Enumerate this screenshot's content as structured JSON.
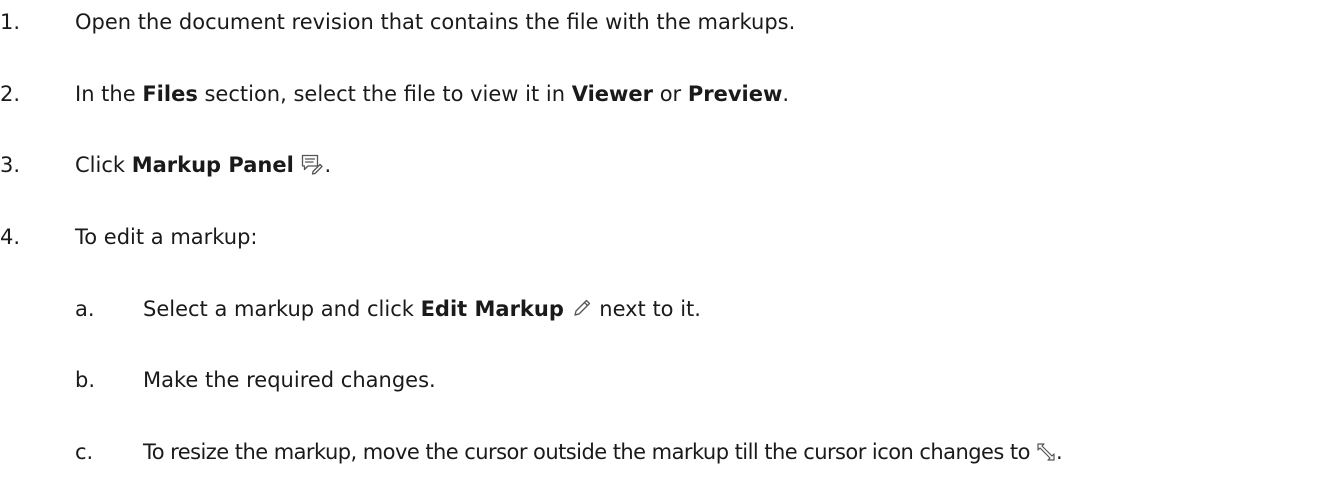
{
  "steps": [
    {
      "num": "1.",
      "text": "Open the document revision that contains the file with the markups."
    },
    {
      "num": "2.",
      "t1": "In the ",
      "b1": "Files",
      "t2": " section, select the file to view it in ",
      "b2": "Viewer",
      "t3": " or ",
      "b3": "Preview",
      "t4": "."
    },
    {
      "num": "3.",
      "t1": "Click ",
      "b1": "Markup Panel",
      "icon": "markup-panel-icon",
      "t2": "."
    },
    {
      "num": "4.",
      "text": "To edit a markup:",
      "substeps": [
        {
          "num": "a.",
          "t1": "Select a markup and click ",
          "b1": "Edit Markup",
          "icon": "edit-markup-pencil-icon",
          "t2": " next to it."
        },
        {
          "num": "b.",
          "text": "Make the required changes."
        },
        {
          "num": "c.",
          "t1": "To resize the markup, move the cursor outside the markup till the cursor icon changes to ",
          "icon": "resize-cursor-icon",
          "t2": "."
        }
      ]
    }
  ],
  "colors": {
    "text": "#1a1a1a",
    "icon": "#555555"
  }
}
